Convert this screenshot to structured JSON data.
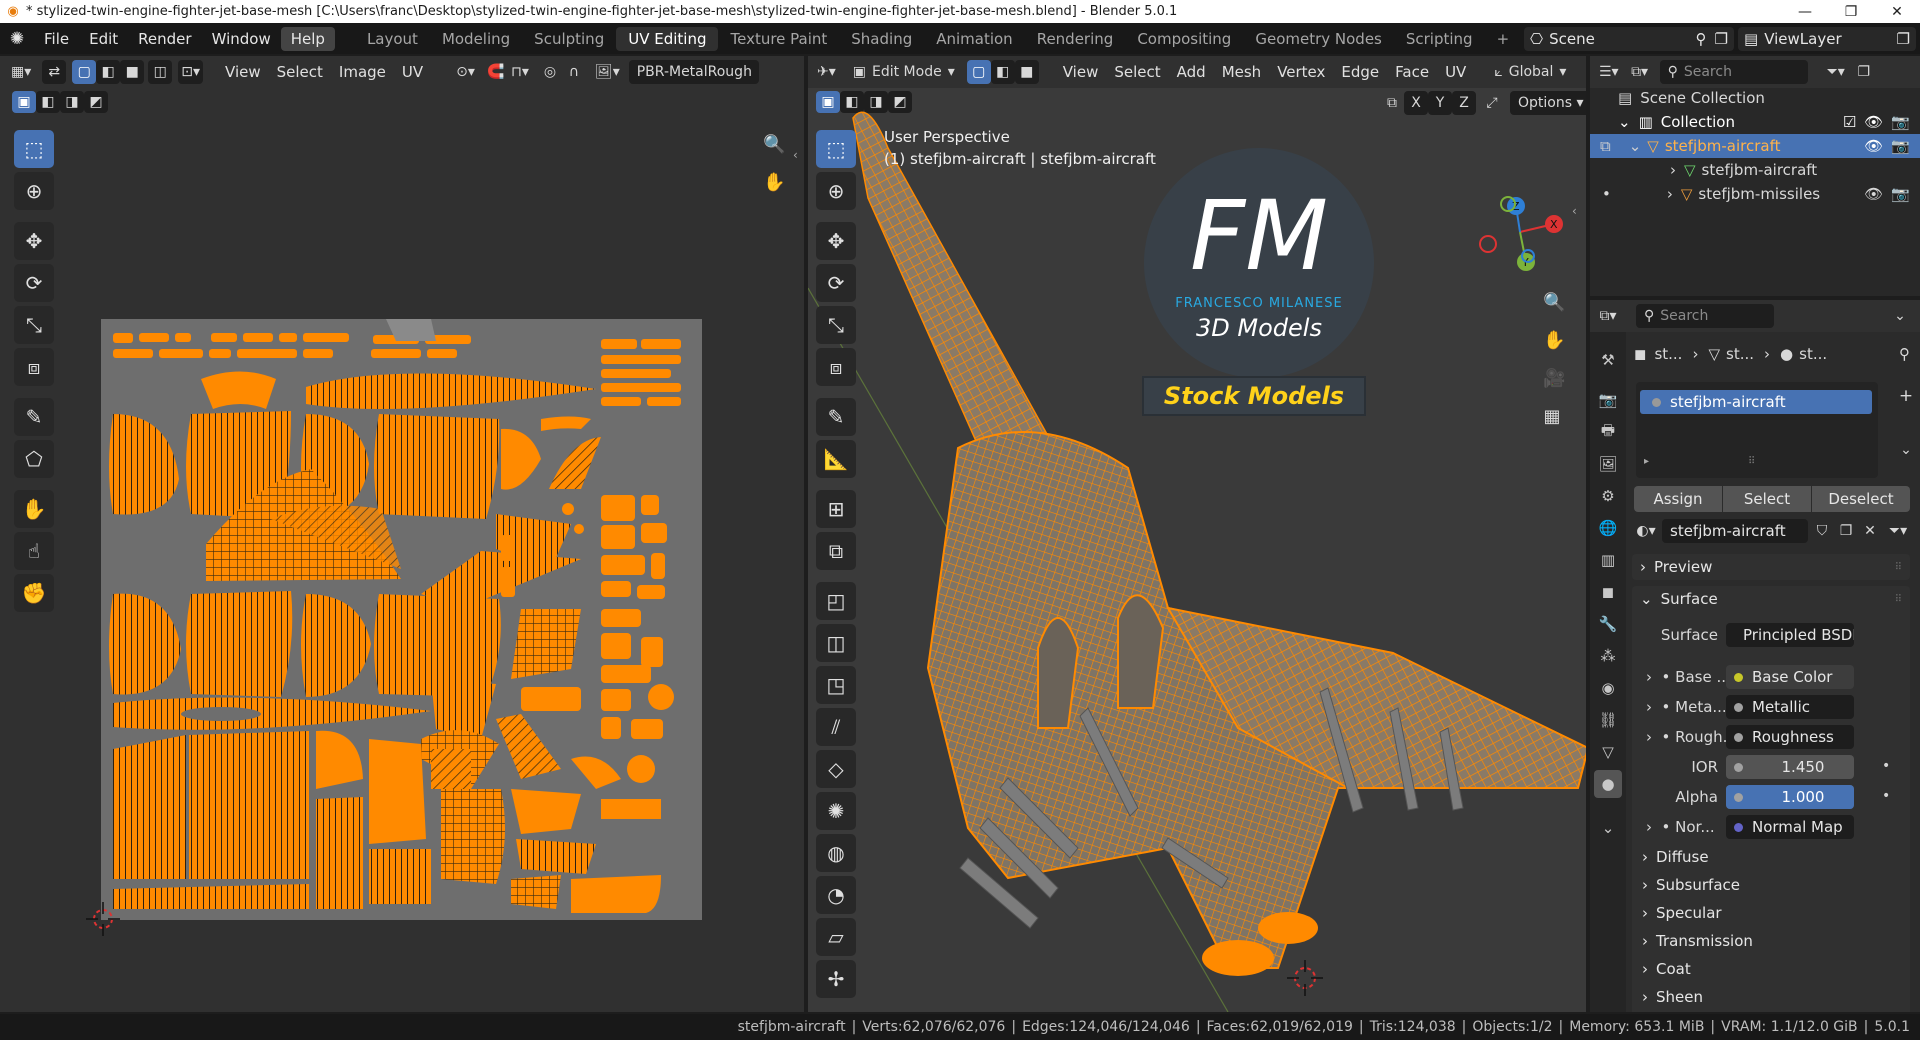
{
  "window": {
    "title": "* stylized-twin-engine-fighter-jet-base-mesh [C:\\Users\\franc\\Desktop\\stylized-twin-engine-fighter-jet-base-mesh\\stylized-twin-engine-fighter-jet-base-mesh.blend] - Blender 5.0.1",
    "minimize": "—",
    "maximize": "❐",
    "close": "✕"
  },
  "menus": [
    "File",
    "Edit",
    "Render",
    "Window",
    "Help"
  ],
  "workspaces": [
    "Layout",
    "Modeling",
    "Sculpting",
    "UV Editing",
    "Texture Paint",
    "Shading",
    "Animation",
    "Rendering",
    "Compositing",
    "Geometry Nodes",
    "Scripting"
  ],
  "active_workspace": "UV Editing",
  "add_workspace": "+",
  "scene": {
    "name": "Scene",
    "view_layer": "ViewLayer"
  },
  "uv_editor": {
    "menus": [
      "View",
      "Select",
      "Image",
      "UV"
    ],
    "image_name": "PBR-MetalRough"
  },
  "viewport": {
    "mode": "Edit Mode",
    "menus": [
      "View",
      "Select",
      "Add",
      "Mesh",
      "Vertex",
      "Edge",
      "Face",
      "UV"
    ],
    "orientation": "Global",
    "options": "Options",
    "perspective": "User Perspective",
    "object_info": "(1) stefjbm-aircraft | stefjbm-aircraft",
    "axes": {
      "x": "X",
      "y": "Y",
      "z": "Z"
    },
    "watermark": {
      "monogram": "FM",
      "name": "FRANCESCO MILANESE",
      "subtitle": "3D Models",
      "banner": "Stock Models"
    }
  },
  "outliner": {
    "search_placeholder": "Search",
    "rows": [
      {
        "label": "Scene Collection"
      },
      {
        "label": "Collection"
      },
      {
        "label": "stefjbm-aircraft"
      },
      {
        "label": "stefjbm-aircraft"
      },
      {
        "label": "stefjbm-missiles"
      }
    ]
  },
  "properties": {
    "search_placeholder": "Search",
    "breadcrumb": [
      "st...",
      "st...",
      "st..."
    ],
    "material_slot": "stefjbm-aircraft",
    "buttons": {
      "assign": "Assign",
      "select": "Select",
      "deselect": "Deselect"
    },
    "material_name": "stefjbm-aircraft",
    "panels": {
      "preview": "Preview",
      "surface": "Surface"
    },
    "surface_label": "Surface",
    "surface_value": "Principled BSDF",
    "inputs": [
      {
        "label": "Base ...",
        "value": "Base Color",
        "color": "#c7c729"
      },
      {
        "label": "Meta...",
        "value": "Metallic",
        "color": "#a1a1a1"
      },
      {
        "label": "Rough...",
        "value": "Roughness",
        "color": "#a1a1a1"
      }
    ],
    "ior_label": "IOR",
    "ior_value": "1.450",
    "alpha_label": "Alpha",
    "alpha_value": "1.000",
    "alpha_level": 1.0,
    "normal_label": "Nor...",
    "normal_value": "Normal Map",
    "subpanels": [
      "Diffuse",
      "Subsurface",
      "Specular",
      "Transmission",
      "Coat",
      "Sheen"
    ]
  },
  "status": {
    "object": "stefjbm-aircraft",
    "verts": "Verts:62,076/62,076",
    "edges": "Edges:124,046/124,046",
    "faces": "Faces:62,019/62,019",
    "tris": "Tris:124,038",
    "objects": "Objects:1/2",
    "memory": "Memory: 653.1 MiB",
    "vram": "VRAM: 1.1/12.0 GiB",
    "version": "5.0.1"
  },
  "colors": {
    "accent": "#4772b3",
    "selection_orange": "#ff8a00",
    "uv_background": "#6e6e6e",
    "logo_cyan": "#29a9e1",
    "banner_text": "#ffd21a"
  }
}
